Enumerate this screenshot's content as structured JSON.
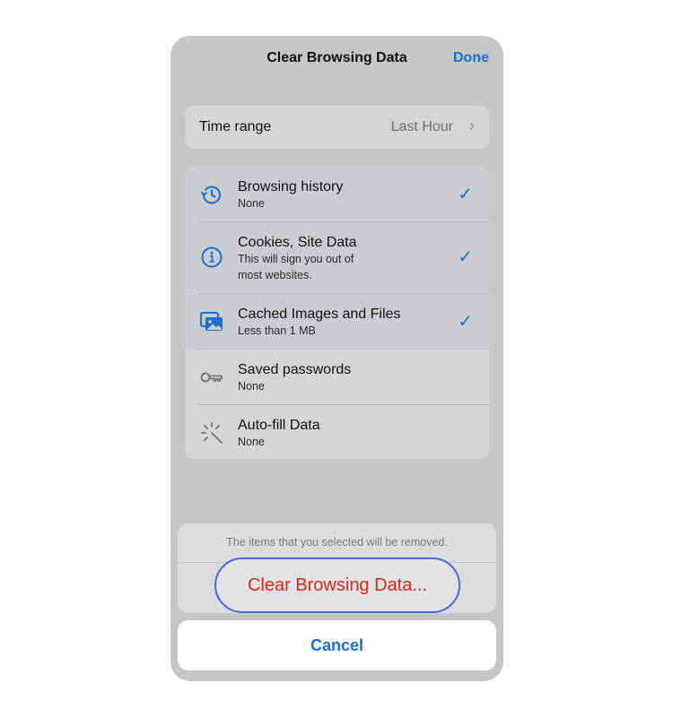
{
  "nav": {
    "title": "Clear Browsing Data",
    "done_label": "Done"
  },
  "time_range": {
    "label": "Time range",
    "value": "Last Hour"
  },
  "items": [
    {
      "title": "Browsing history",
      "subtitle_lines": [
        "None"
      ],
      "selected": true,
      "icon": "history-icon"
    },
    {
      "title": "Cookies, Site Data",
      "subtitle_lines": [
        "This will sign you out of",
        "most websites."
      ],
      "selected": true,
      "icon": "info-icon"
    },
    {
      "title": "Cached Images and Files",
      "subtitle_lines": [
        "Less than 1 MB"
      ],
      "selected": true,
      "icon": "images-icon"
    },
    {
      "title": "Saved passwords",
      "subtitle_lines": [
        "None"
      ],
      "selected": false,
      "icon": "key-icon"
    },
    {
      "title": "Auto-fill Data",
      "subtitle_lines": [
        "None"
      ],
      "selected": false,
      "icon": "autofill-wand-icon"
    }
  ],
  "sheet": {
    "message": "The items that you selected will be removed.",
    "clear_label": "Clear Browsing Data...",
    "cancel_label": "Cancel"
  },
  "colors": {
    "accent": "#1a6fd0",
    "destructive": "#d4281d",
    "focus_ring": "#4a67e0"
  }
}
